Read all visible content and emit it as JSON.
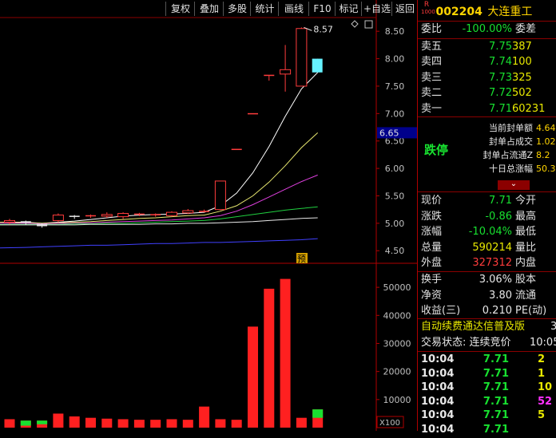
{
  "toolbar": {
    "buttons": [
      "复权",
      "叠加",
      "多股",
      "统计",
      "画线",
      "F10",
      "标记",
      "+自选",
      "返回"
    ]
  },
  "stock": {
    "badge_top": "R",
    "badge_bottom": "1000",
    "code": "002204",
    "name": "大连重工"
  },
  "weibi": {
    "label": "委比",
    "value": "-100.00%",
    "label2": "委差"
  },
  "sell_orders": [
    {
      "label": "卖五",
      "price": "7.75",
      "vol": "387"
    },
    {
      "label": "卖四",
      "price": "7.74",
      "vol": "100"
    },
    {
      "label": "卖三",
      "price": "7.73",
      "vol": "325"
    },
    {
      "label": "卖二",
      "price": "7.72",
      "vol": "502"
    },
    {
      "label": "卖一",
      "price": "7.71",
      "vol": "60231"
    }
  ],
  "limit_panel": {
    "status": "跌停",
    "items": [
      {
        "label": "当前封单额",
        "value": "4.64"
      },
      {
        "label": "封单占成交",
        "value": "1.02"
      },
      {
        "label": "封单占流通Z",
        "value": "8.2"
      },
      {
        "label": "十日总涨幅",
        "value": "50.3"
      }
    ],
    "expand_glyph": "⌄"
  },
  "quote": [
    {
      "l1": "现价",
      "v": "7.71",
      "l2": "今开",
      "c": "green"
    },
    {
      "l1": "涨跌",
      "v": "-0.86",
      "l2": "最高",
      "c": "green"
    },
    {
      "l1": "涨幅",
      "v": "-10.04%",
      "l2": "最低",
      "c": "green"
    },
    {
      "l1": "总量",
      "v": "590214",
      "l2": "量比",
      "c": "yellow"
    },
    {
      "l1": "外盘",
      "v": "327312",
      "l2": "内盘",
      "c": "red"
    }
  ],
  "fund": [
    {
      "l1": "换手",
      "v": "3.06%",
      "l2": "股本"
    },
    {
      "l1": "净资",
      "v": "3.80",
      "l2": "流通"
    },
    {
      "l1": "收益(三)",
      "v": "0.210",
      "l2": "PE(动)"
    }
  ],
  "ad_text": "自动续费通达信普及版",
  "ad_suffix": "3",
  "trade_status": "交易状态: 连续竞价",
  "trade_time": "10:05",
  "ticks": [
    {
      "time": "10:04",
      "price": "7.71",
      "vol": "2",
      "vc": "yellow"
    },
    {
      "time": "10:04",
      "price": "7.71",
      "vol": "1",
      "vc": "yellow"
    },
    {
      "time": "10:04",
      "price": "7.71",
      "vol": "10",
      "vc": "yellow"
    },
    {
      "time": "10:04",
      "price": "7.71",
      "vol": "52",
      "vc": "magenta"
    },
    {
      "time": "10:04",
      "price": "7.71",
      "vol": "5",
      "vc": "yellow"
    },
    {
      "time": "10:04",
      "price": "7.71",
      "vol": "",
      "vc": "yellow"
    }
  ],
  "chart_data": {
    "type": "candlestick",
    "price_axis": {
      "ticks": [
        "8.50",
        "8.00",
        "7.50",
        "7.00",
        "6.50",
        "6.00",
        "5.50",
        "5.00",
        "4.50"
      ],
      "range": [
        4.3,
        8.75
      ]
    },
    "current_price_tag": "6.65",
    "high_annotation": "8.57",
    "pred_label": "预",
    "candles": [
      {
        "o": 5.02,
        "c": 5.05,
        "h": 5.08,
        "l": 4.98
      },
      {
        "o": 5.03,
        "c": 5.0,
        "h": 5.05,
        "l": 4.97
      },
      {
        "o": 4.98,
        "c": 4.94,
        "h": 5.0,
        "l": 4.92
      },
      {
        "o": 5.05,
        "c": 5.15,
        "h": 5.18,
        "l": 5.02
      },
      {
        "o": 5.13,
        "c": 5.12,
        "h": 5.15,
        "l": 5.08
      },
      {
        "o": 5.12,
        "c": 5.14,
        "h": 5.16,
        "l": 5.1
      },
      {
        "o": 5.13,
        "c": 5.16,
        "h": 5.2,
        "l": 5.1
      },
      {
        "o": 5.12,
        "c": 5.18,
        "h": 5.2,
        "l": 5.08
      },
      {
        "o": 5.16,
        "c": 5.17,
        "h": 5.19,
        "l": 5.13
      },
      {
        "o": 5.14,
        "c": 5.16,
        "h": 5.18,
        "l": 5.12
      },
      {
        "o": 5.14,
        "c": 5.2,
        "h": 5.22,
        "l": 5.12
      },
      {
        "o": 5.19,
        "c": 5.23,
        "h": 5.26,
        "l": 5.17
      },
      {
        "o": 5.22,
        "c": 5.22,
        "h": 5.25,
        "l": 5.2
      },
      {
        "o": 5.25,
        "c": 5.77,
        "h": 5.77,
        "l": 5.24
      },
      {
        "o": 6.35,
        "c": 6.35,
        "h": 6.35,
        "l": 6.35
      },
      {
        "o": 7.0,
        "c": 7.0,
        "h": 7.0,
        "l": 7.0
      },
      {
        "o": 7.7,
        "c": 7.7,
        "h": 7.7,
        "l": 7.6
      },
      {
        "o": 7.72,
        "c": 7.8,
        "h": 8.25,
        "l": 7.4
      },
      {
        "o": 7.5,
        "c": 8.55,
        "h": 8.57,
        "l": 7.5
      },
      {
        "o": 8.0,
        "c": 7.75,
        "h": 8.0,
        "l": 7.75
      }
    ],
    "ma_series": [
      {
        "name": "MA5",
        "color": "#ffffff",
        "values": [
          5.02,
          5.02,
          5.0,
          5.02,
          5.04,
          5.07,
          5.1,
          5.13,
          5.15,
          5.16,
          5.17,
          5.18,
          5.2,
          5.32,
          5.55,
          5.92,
          6.4,
          6.95,
          7.45,
          7.75
        ]
      },
      {
        "name": "MA10",
        "color": "#e8e870",
        "values": [
          5.02,
          5.01,
          5.0,
          5.01,
          5.02,
          5.03,
          5.05,
          5.07,
          5.09,
          5.1,
          5.12,
          5.14,
          5.15,
          5.22,
          5.32,
          5.5,
          5.75,
          6.05,
          6.38,
          6.65
        ]
      },
      {
        "name": "MA20",
        "color": "#e040e0",
        "values": [
          5.0,
          5.0,
          4.99,
          5.0,
          5.0,
          5.01,
          5.02,
          5.03,
          5.04,
          5.05,
          5.06,
          5.08,
          5.1,
          5.14,
          5.22,
          5.34,
          5.48,
          5.62,
          5.76,
          5.88
        ]
      },
      {
        "name": "MA30",
        "color": "#20d040",
        "values": [
          4.98,
          4.98,
          4.98,
          4.98,
          4.99,
          4.99,
          5.0,
          5.0,
          5.01,
          5.02,
          5.03,
          5.04,
          5.05,
          5.08,
          5.12,
          5.16,
          5.2,
          5.24,
          5.27,
          5.3
        ]
      },
      {
        "name": "MA60",
        "color": "#e8e8e8",
        "values": [
          4.97,
          4.97,
          4.97,
          4.97,
          4.97,
          4.98,
          4.98,
          4.98,
          4.98,
          4.99,
          4.99,
          5.0,
          5.0,
          5.01,
          5.02,
          5.03,
          5.05,
          5.07,
          5.09,
          5.1
        ]
      },
      {
        "name": "MA120",
        "color": "#4040ff",
        "values": [
          4.55,
          4.56,
          4.57,
          4.58,
          4.59,
          4.6,
          4.6,
          4.61,
          4.62,
          4.63,
          4.63,
          4.64,
          4.65,
          4.65,
          4.66,
          4.67,
          4.68,
          4.69,
          4.7,
          4.72
        ]
      }
    ],
    "volume_axis": {
      "ticks": [
        "50000",
        "40000",
        "30000",
        "20000",
        "10000"
      ],
      "unit": "X100",
      "range": [
        0,
        58000
      ]
    },
    "volume": [
      3000,
      2500,
      2500,
      5000,
      4000,
      3500,
      3200,
      3000,
      2800,
      2800,
      3000,
      2800,
      7500,
      3000,
      2800,
      36000,
      49500,
      53000,
      3500,
      6500
    ],
    "volume_green_top": [
      0,
      1800,
      1300,
      0,
      0,
      0,
      0,
      0,
      0,
      0,
      0,
      0,
      0,
      0,
      0,
      0,
      0,
      0,
      0,
      3000
    ]
  }
}
